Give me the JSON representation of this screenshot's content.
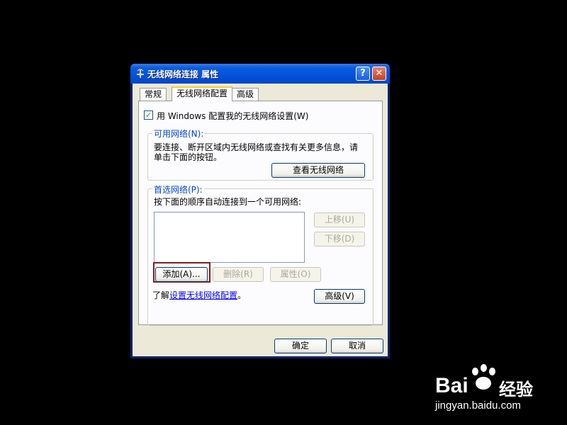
{
  "window": {
    "title": "无线网络连接 属性",
    "help_glyph": "?",
    "close_glyph": "✕",
    "icon": "network-connection-icon"
  },
  "tabs": [
    {
      "label": "常规",
      "active": false
    },
    {
      "label": "无线网络配置",
      "active": true
    },
    {
      "label": "高级",
      "active": false
    }
  ],
  "panel": {
    "use_windows_checkbox": {
      "label": "用 Windows 配置我的无线网络设置(W)",
      "checked": true
    },
    "available_networks": {
      "legend": "可用网络(N):",
      "description_line1": "要连接、断开区域内无线网络或查找有关更多信息，请",
      "description_line2": "单击下面的按钮。",
      "view_button": "查看无线网络"
    },
    "preferred_networks": {
      "legend": "首选网络(P):",
      "description": "按下面的顺序自动连接到一个可用网络:",
      "move_up_button": "上移(U)",
      "move_down_button": "下移(D)",
      "add_button": "添加(A)...",
      "remove_button": "删除(R)",
      "properties_button": "属性(O)",
      "learn_prefix": "了解",
      "learn_link": "设置无线网络配置",
      "learn_suffix": "。",
      "advanced_button": "高级(V)"
    }
  },
  "footer": {
    "ok_button": "确定",
    "cancel_button": "取消"
  },
  "watermark": {
    "brand_left": "Bai",
    "brand_right": "经验",
    "url": "jingyan.baidu.com"
  },
  "colors": {
    "titlebar": "#0352d8",
    "dialog_bg": "#ece9d8",
    "highlight_box": "#8b1a1a",
    "legend_text": "#0046d5"
  }
}
